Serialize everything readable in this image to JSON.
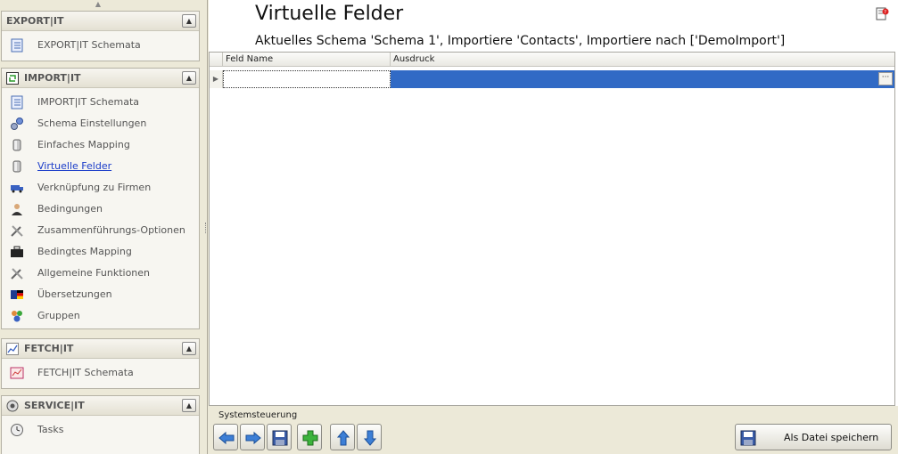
{
  "sidebar": {
    "groups": [
      {
        "title": "EXPORT|IT",
        "items": [
          {
            "label": "EXPORT|IT Schemata"
          }
        ]
      },
      {
        "title": "IMPORT|IT",
        "items": [
          {
            "label": "IMPORT|IT Schemata"
          },
          {
            "label": "Schema Einstellungen"
          },
          {
            "label": "Einfaches Mapping"
          },
          {
            "label": "Virtuelle Felder"
          },
          {
            "label": "Verknüpfung zu Firmen"
          },
          {
            "label": "Bedingungen"
          },
          {
            "label": "Zusammenführungs-Optionen"
          },
          {
            "label": "Bedingtes Mapping"
          },
          {
            "label": "Allgemeine Funktionen"
          },
          {
            "label": "Übersetzungen"
          },
          {
            "label": "Gruppen"
          }
        ]
      },
      {
        "title": "FETCH|IT",
        "items": [
          {
            "label": "FETCH|IT Schemata"
          }
        ]
      },
      {
        "title": "SERVICE|IT",
        "items": [
          {
            "label": "Tasks"
          }
        ]
      }
    ],
    "active_item": "Virtuelle Felder"
  },
  "main": {
    "title": "Virtuelle Felder",
    "subtitle": "Aktuelles Schema 'Schema 1', Importiere 'Contacts', Importiere nach ['DemoImport']",
    "grid": {
      "columns": [
        "Feld Name",
        "Ausdruck"
      ],
      "rows": [
        {
          "feld_name": "",
          "ausdruck": ""
        }
      ],
      "selection_color": "#316ac5"
    },
    "toolbar": {
      "label": "Systemsteuerung",
      "save_file_label": "Als Datei speichern"
    }
  },
  "icons": {
    "help": "help-icon",
    "back": "arrow-left-icon",
    "forward": "arrow-right-icon",
    "save": "floppy-disk-icon",
    "add": "plus-icon",
    "up": "arrow-up-icon",
    "down": "arrow-down-icon"
  }
}
